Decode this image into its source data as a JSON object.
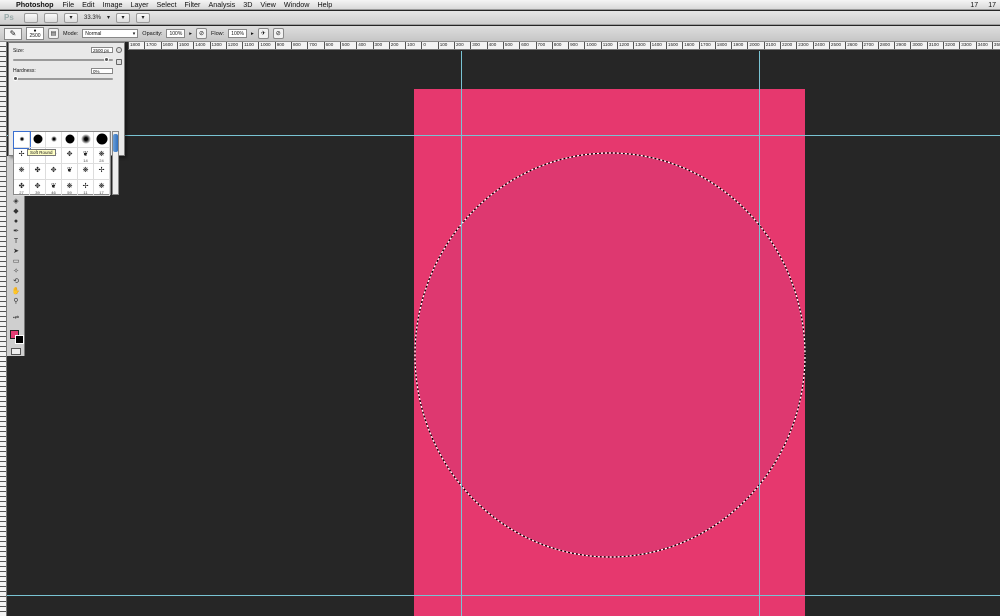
{
  "menubar": {
    "app_name": "Photoshop",
    "items": [
      "File",
      "Edit",
      "Image",
      "Layer",
      "Select",
      "Filter",
      "Analysis",
      "3D",
      "View",
      "Window",
      "Help"
    ],
    "status": [
      "17",
      "17"
    ]
  },
  "appbar": {
    "logo": "Ps",
    "zoom": "33.3%"
  },
  "options": {
    "brush_size": "2500",
    "mode_label": "Mode:",
    "mode_value": "Normal",
    "opacity_label": "Opacity:",
    "opacity_value": "100%",
    "flow_label": "Flow:",
    "flow_value": "100%"
  },
  "ruler": {
    "ticks": [
      "1800",
      "1700",
      "1600",
      "1500",
      "1400",
      "1300",
      "1200",
      "1100",
      "1000",
      "900",
      "800",
      "700",
      "600",
      "500",
      "400",
      "300",
      "200",
      "100",
      "0",
      "100",
      "200",
      "300",
      "400",
      "500",
      "600",
      "700",
      "800",
      "900",
      "1000",
      "1100",
      "1200",
      "1300",
      "1400",
      "1500",
      "1600",
      "1700",
      "1800",
      "1900",
      "2000",
      "2100",
      "2200",
      "2300",
      "2400",
      "2500",
      "2600",
      "2700",
      "2800",
      "2900",
      "3000",
      "3100",
      "3200",
      "3300",
      "3400",
      "3500",
      "3600"
    ]
  },
  "brush_picker": {
    "size_label": "Size:",
    "size_value": "2500 px",
    "size_fraction": 0.95,
    "hardness_label": "Hardness:",
    "hardness_value": "0%",
    "hardness_fraction": 0.0,
    "tooltip": "Soft Round",
    "presets": [
      {
        "num": ""
      },
      {
        "num": ""
      },
      {
        "num": ""
      },
      {
        "num": ""
      },
      {
        "num": ""
      },
      {
        "num": ""
      },
      {
        "num": ""
      },
      {
        "num": ""
      },
      {
        "num": ""
      },
      {
        "num": ""
      },
      {
        "num": "14"
      },
      {
        "num": "24"
      },
      {
        "num": ""
      },
      {
        "num": ""
      },
      {
        "num": ""
      },
      {
        "num": ""
      },
      {
        "num": ""
      },
      {
        "num": ""
      },
      {
        "num": "27"
      },
      {
        "num": "39"
      },
      {
        "num": "46"
      },
      {
        "num": "59"
      },
      {
        "num": "11"
      },
      {
        "num": "17"
      }
    ]
  },
  "colors": {
    "foreground": "#e23d74",
    "background": "#000000",
    "document": "#e6386e",
    "pasteboard": "#262626",
    "guides": "#79c3d3"
  }
}
